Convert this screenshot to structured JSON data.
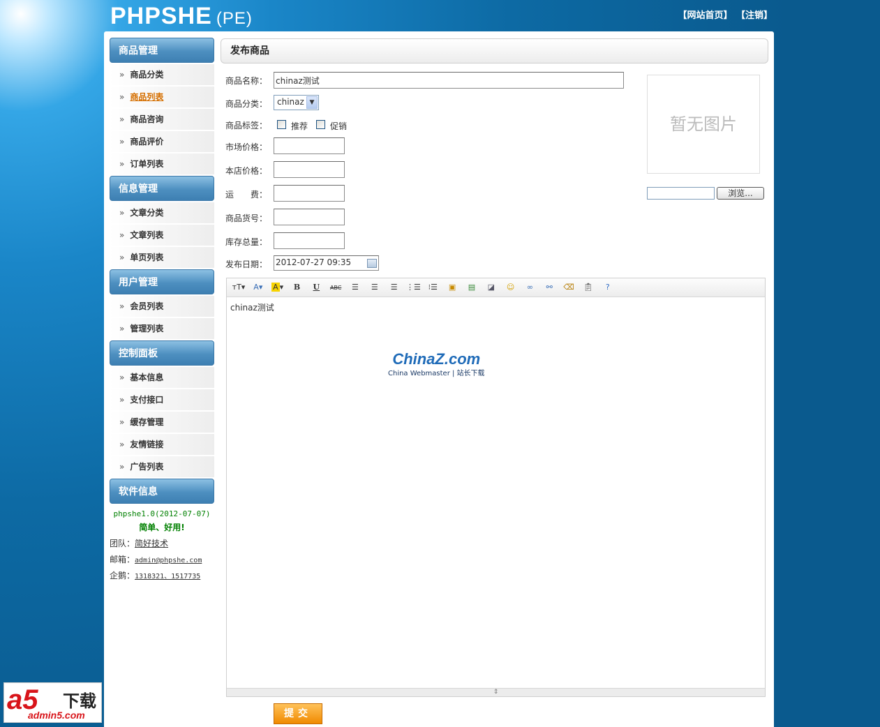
{
  "header": {
    "logo": "PHPSHE",
    "logo_sub": "(PE)",
    "links": [
      "【网站首页】",
      "【注销】"
    ]
  },
  "sidebar": {
    "groups": [
      {
        "title": "商品管理",
        "items": [
          "商品分类",
          "商品列表",
          "商品咨询",
          "商品评价",
          "订单列表"
        ]
      },
      {
        "title": "信息管理",
        "items": [
          "文章分类",
          "文章列表",
          "单页列表"
        ]
      },
      {
        "title": "用户管理",
        "items": [
          "会员列表",
          "管理列表"
        ]
      },
      {
        "title": "控制面板",
        "items": [
          "基本信息",
          "支付接口",
          "缓存管理",
          "友情链接",
          "广告列表"
        ]
      },
      {
        "title": "软件信息",
        "items": []
      }
    ],
    "active_item": "商品列表",
    "arrow": "»",
    "software": {
      "version": "phpshe1.0(2012-07-07)",
      "slogan": "简单、好用!",
      "team_label": "团队：",
      "team_value": "简好技术",
      "email_label": "邮箱：",
      "email_value": "admin@phpshe.com",
      "qq_label": "企鹅：",
      "qq_value": "1318321、1517735"
    }
  },
  "main": {
    "title": "发布商品",
    "form": {
      "name_label": "商品名称：",
      "name_value": "chinaz测试",
      "category_label": "商品分类：",
      "category_value": "chinaz",
      "tag_label": "商品标签：",
      "tag_options": [
        "推荐",
        "促销"
      ],
      "market_price_label": "市场价格：",
      "market_price_value": "",
      "shop_price_label": "本店价格：",
      "shop_price_value": "",
      "freight_label": "运　　费：",
      "freight_value": "",
      "sku_label": "商品货号：",
      "sku_value": "",
      "stock_label": "库存总量：",
      "stock_value": "",
      "date_label": "发布日期：",
      "date_value": "2012-07-27 09:35"
    },
    "image": {
      "placeholder": "暂无图片",
      "browse_label": "浏览..."
    },
    "editor": {
      "toolbar": [
        "TT",
        "A",
        "A",
        "B",
        "U",
        "ABC",
        "align-left",
        "align-center",
        "align-right",
        "ordered-list",
        "unordered-list",
        "image",
        "image-gallery",
        "flash",
        "emoticon",
        "link",
        "unlink",
        "clear-format",
        "paste",
        "help"
      ],
      "content": "chinaz测试",
      "watermark_main": "ChinaZ.com",
      "watermark_sub": "China Webmaster | 站长下载"
    },
    "submit_label": "提交"
  },
  "corner_logo": {
    "mark": "a5",
    "text": "下载",
    "url": "admin5.com"
  },
  "colors": {
    "accent_blue": "#4d8fc0",
    "active_orange": "#d56f00",
    "submit_orange": "#f08a00",
    "background_blue": "#0d6aa4"
  }
}
